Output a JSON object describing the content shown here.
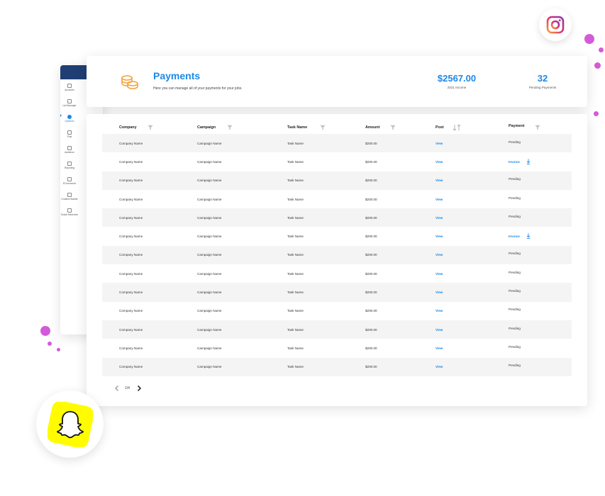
{
  "sidebar": {
    "items": [
      {
        "label": "Accounts",
        "active": false
      },
      {
        "label": "List Manager",
        "active": false
      },
      {
        "label": "Optimize",
        "active": true
      },
      {
        "label": "Post",
        "active": false
      },
      {
        "label": "Audience",
        "active": false
      },
      {
        "label": "Reporting",
        "active": false
      },
      {
        "label": "ECommerce",
        "active": false
      },
      {
        "label": "Creative Builder",
        "active": false
      },
      {
        "label": "Social Influencer",
        "active": false
      }
    ]
  },
  "header": {
    "title": "Payments",
    "subtitle": "Here you can manage all of your payments for your jobs.",
    "income_value": "$2567.00",
    "income_label": "2021 Income",
    "pending_value": "32",
    "pending_label": "Pending Payments",
    "icon": "coins-icon"
  },
  "table": {
    "columns": [
      "Company",
      "Campaign",
      "Task Name",
      "Amount",
      "Post",
      "Payment"
    ],
    "rows": [
      {
        "company": "Company Name",
        "campaign": "Campaign Name",
        "task": "Task Name",
        "amount": "$200.00",
        "post": "View",
        "payment": "Pending",
        "invoice": false
      },
      {
        "company": "Company Name",
        "campaign": "Campaign Name",
        "task": "Task Name",
        "amount": "$200.00",
        "post": "View",
        "payment": "Invoice",
        "invoice": true
      },
      {
        "company": "Company Name",
        "campaign": "Campaign Name",
        "task": "Task Name",
        "amount": "$200.00",
        "post": "View",
        "payment": "Pending",
        "invoice": false
      },
      {
        "company": "Company Name",
        "campaign": "Campaign Name",
        "task": "Task Name",
        "amount": "$200.00",
        "post": "View",
        "payment": "Pending",
        "invoice": false
      },
      {
        "company": "Company Name",
        "campaign": "Campaign Name",
        "task": "Task Name",
        "amount": "$200.00",
        "post": "View",
        "payment": "Pending",
        "invoice": false
      },
      {
        "company": "Company Name",
        "campaign": "Campaign Name",
        "task": "Task Name",
        "amount": "$200.00",
        "post": "View",
        "payment": "Invoice",
        "invoice": true
      },
      {
        "company": "Company Name",
        "campaign": "Campaign Name",
        "task": "Task Name",
        "amount": "$200.00",
        "post": "View",
        "payment": "Pending",
        "invoice": false
      },
      {
        "company": "Company Name",
        "campaign": "Campaign Name",
        "task": "Task Name",
        "amount": "$200.00",
        "post": "View",
        "payment": "Pending",
        "invoice": false
      },
      {
        "company": "Company Name",
        "campaign": "Campaign Name",
        "task": "Task Name",
        "amount": "$200.00",
        "post": "View",
        "payment": "Pending",
        "invoice": false
      },
      {
        "company": "Company Name",
        "campaign": "Campaign Name",
        "task": "Task Name",
        "amount": "$200.00",
        "post": "View",
        "payment": "Pending",
        "invoice": false
      },
      {
        "company": "Company Name",
        "campaign": "Campaign Name",
        "task": "Task Name",
        "amount": "$200.00",
        "post": "View",
        "payment": "Pending",
        "invoice": false
      },
      {
        "company": "Company Name",
        "campaign": "Campaign Name",
        "task": "Task Name",
        "amount": "$200.00",
        "post": "View",
        "payment": "Pending",
        "invoice": false
      },
      {
        "company": "Company Name",
        "campaign": "Campaign Name",
        "task": "Task Name",
        "amount": "$200.00",
        "post": "View",
        "payment": "Pending",
        "invoice": false
      }
    ]
  },
  "pagination": {
    "label": "1/4"
  },
  "social": {
    "top_icon": "instagram-icon",
    "bottom_icon": "snapchat-icon"
  },
  "colors": {
    "accent": "#1e88e5",
    "navy": "#1f3f74",
    "coin": "#f2a33a",
    "dots": "#d35bd8",
    "snap": "#fffc00"
  }
}
